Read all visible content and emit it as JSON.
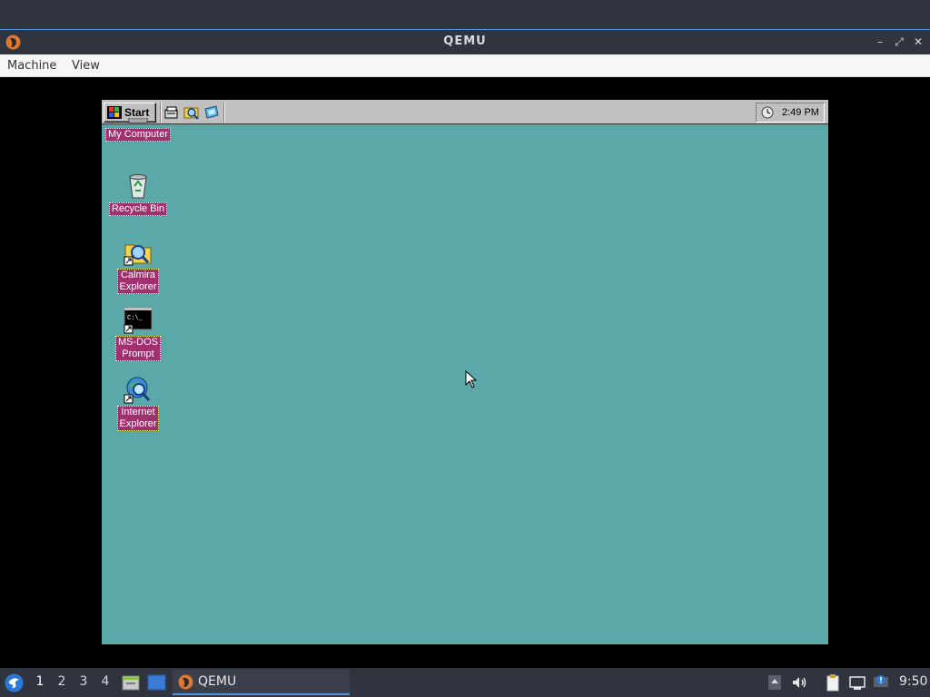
{
  "qemu": {
    "title": "QEMU",
    "controls": {
      "minimize": "–",
      "maximize": "⤢",
      "close": "✕"
    },
    "menu": [
      "Machine",
      "View"
    ]
  },
  "guest": {
    "background": "#5ba8a8",
    "taskbar": {
      "start_label": "Start",
      "quicklaunch": [
        "show-desktop-icon",
        "explorer-icon",
        "channels-icon"
      ],
      "clock": "2:49 PM"
    },
    "desktop_icons": [
      {
        "name": "my-computer",
        "label": "My Computer",
        "icon": "computer-icon"
      },
      {
        "name": "recycle-bin",
        "label": "Recycle Bin",
        "icon": "recycle-bin-icon"
      },
      {
        "name": "calmira-explorer",
        "label": "Calmira\nExplorer",
        "icon": "folder-magnifier-icon"
      },
      {
        "name": "ms-dos-prompt",
        "label": "MS-DOS\nPrompt",
        "icon": "dos-prompt-icon"
      },
      {
        "name": "internet-explorer",
        "label": "Internet\nExplorer",
        "icon": "globe-magnifier-icon"
      }
    ],
    "label_highlight": "#a0306e"
  },
  "host_panel": {
    "workspaces": [
      "1",
      "2",
      "3",
      "4"
    ],
    "active_workspace": "1",
    "task": "QEMU",
    "clock": "9:50",
    "accent": "#5294e2"
  }
}
